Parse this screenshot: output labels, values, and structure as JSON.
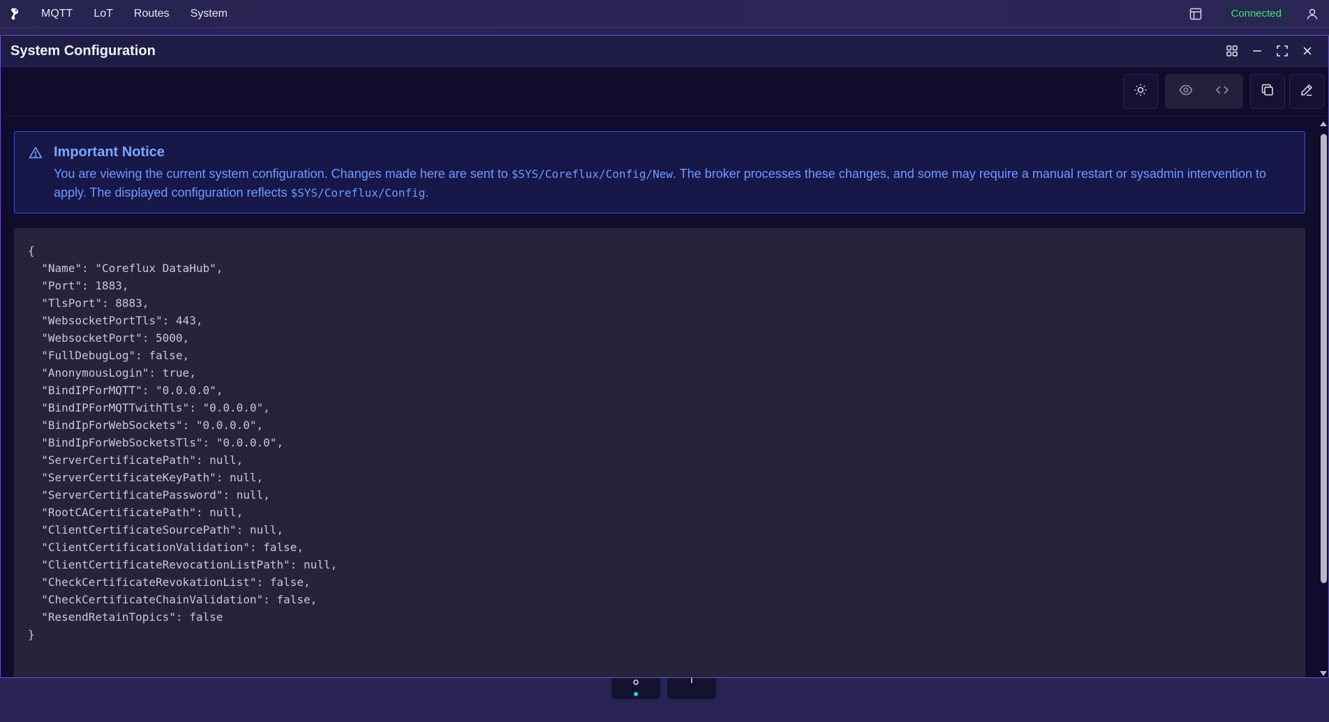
{
  "nav": {
    "items": [
      {
        "label": "MQTT"
      },
      {
        "label": "LoT"
      },
      {
        "label": "Routes"
      },
      {
        "label": "System"
      }
    ],
    "status": "Connected",
    "status_color": "#4ade80"
  },
  "window": {
    "title": "System Configuration"
  },
  "notice": {
    "title": "Important Notice",
    "text_1": "You are viewing the current system configuration. Changes made here are sent to ",
    "topic_new": "$SYS/Coreflux/Config/New",
    "text_2": ". The broker processes these changes, and some may require a manual restart or sysadmin intervention to apply. The displayed configuration reflects ",
    "topic_config": "$SYS/Coreflux/Config",
    "text_3": "."
  },
  "config_lines": [
    "{",
    "  \"Name\": \"Coreflux DataHub\",",
    "  \"Port\": 1883,",
    "  \"TlsPort\": 8883,",
    "  \"WebsocketPortTls\": 443,",
    "  \"WebsocketPort\": 5000,",
    "  \"FullDebugLog\": false,",
    "  \"AnonymousLogin\": true,",
    "  \"BindIPForMQTT\": \"0.0.0.0\",",
    "  \"BindIPForMQTTwithTls\": \"0.0.0.0\",",
    "  \"BindIpForWebSockets\": \"0.0.0.0\",",
    "  \"BindIpForWebSocketsTls\": \"0.0.0.0\",",
    "  \"ServerCertificatePath\": null,",
    "  \"ServerCertificateKeyPath\": null,",
    "  \"ServerCertificatePassword\": null,",
    "  \"RootCACertificatePath\": null,",
    "  \"ClientCertificateSourcePath\": null,",
    "  \"ClientCertificationValidation\": false,",
    "  \"ClientCertificateRevocationListPath\": null,",
    "  \"CheckCertificateRevokationList\": false,",
    "  \"CheckCertificateChainValidation\": false,",
    "  \"ResendRetainTopics\": false",
    "}"
  ]
}
